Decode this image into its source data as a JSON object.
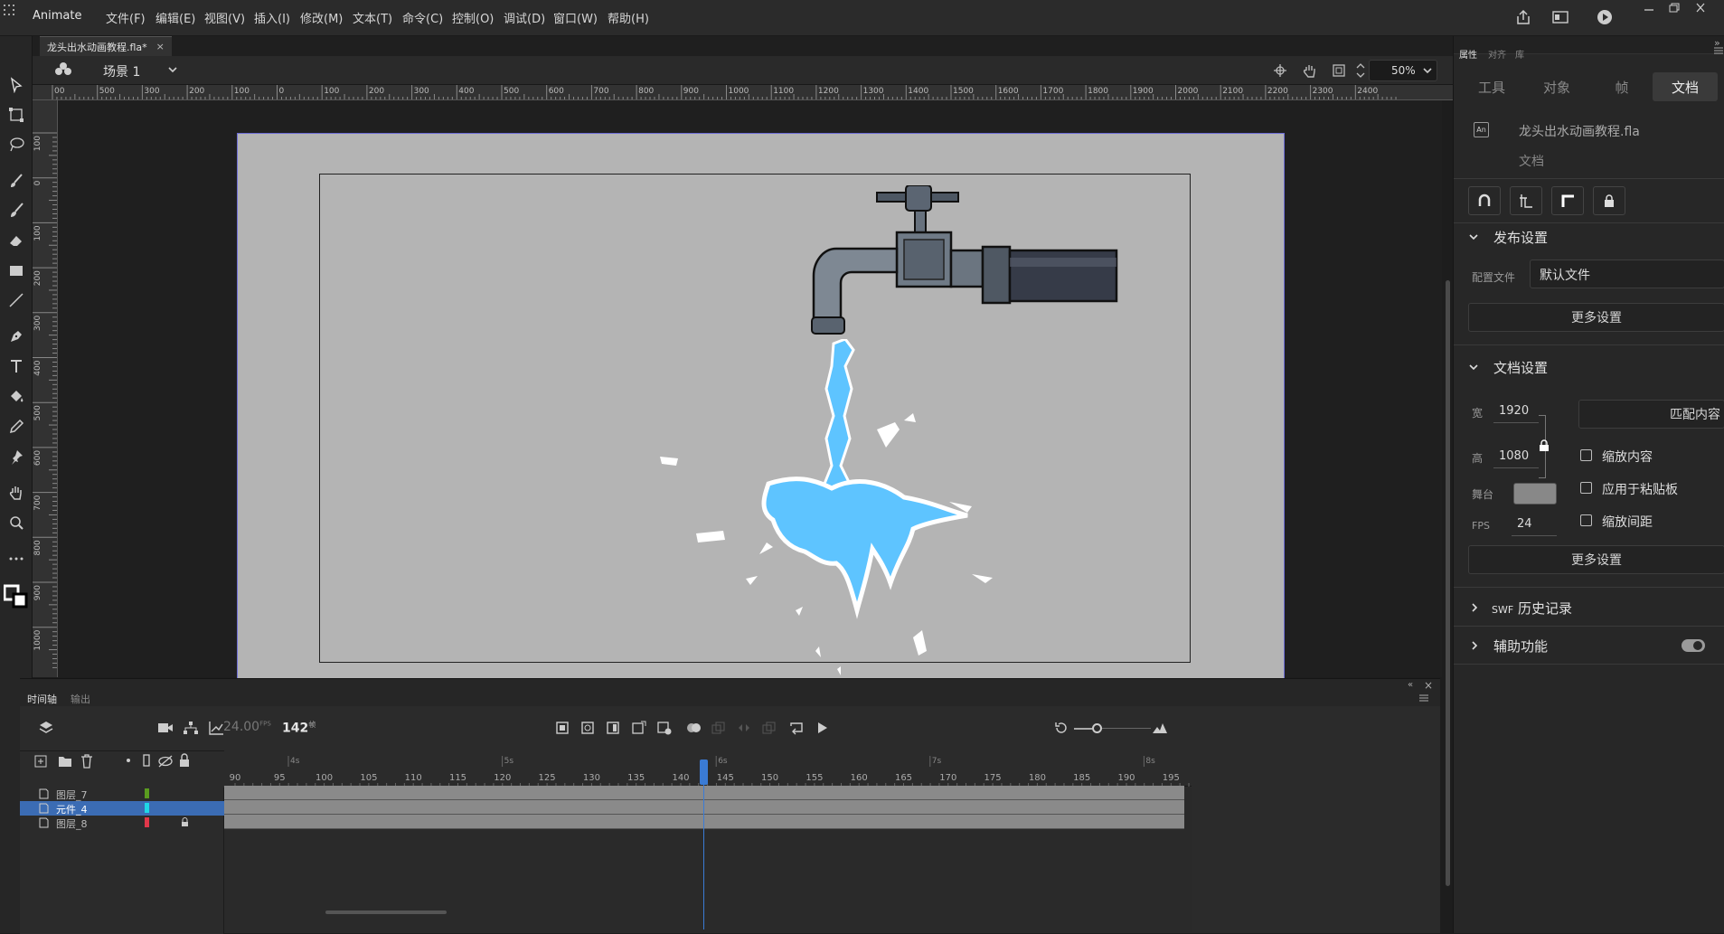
{
  "app": {
    "name": "Animate"
  },
  "menu": [
    "文件(F)",
    "编辑(E)",
    "视图(V)",
    "插入(I)",
    "修改(M)",
    "文本(T)",
    "命令(C)",
    "控制(O)",
    "调试(D)",
    "窗口(W)",
    "帮助(H)"
  ],
  "document": {
    "tab_label": "龙头出水动画教程.fla*"
  },
  "scene": {
    "label": "场景 1",
    "zoom": "50%"
  },
  "rulers": {
    "h_labels": [
      "00",
      "500",
      "300",
      "200",
      "100",
      "0",
      "100",
      "200",
      "300",
      "400",
      "500",
      "600",
      "700",
      "800",
      "900",
      "1000",
      "1100",
      "1200",
      "1300",
      "1400",
      "1500",
      "1600",
      "1700",
      "1800",
      "1900",
      "2000",
      "2100",
      "2200",
      "2300",
      "2400"
    ],
    "v_labels": [
      "100",
      "0",
      "100",
      "200",
      "300",
      "400",
      "500",
      "600",
      "700",
      "800",
      "900",
      "1000"
    ]
  },
  "timeline": {
    "tabs": [
      "时间轴",
      "输出"
    ],
    "fps": "24.00",
    "fps_unit": "FPS",
    "frame": "142",
    "frame_unit": "帧",
    "second_marks": [
      "4s",
      "5s",
      "6s",
      "7s",
      "8s"
    ],
    "frame_numbers": [
      "90",
      "95",
      "100",
      "105",
      "110",
      "115",
      "120",
      "125",
      "130",
      "135",
      "140",
      "145",
      "150",
      "155",
      "160",
      "165",
      "170",
      "175",
      "180",
      "185",
      "190",
      "195"
    ],
    "layers": [
      {
        "name": "图层_7",
        "color": "#5a9b1f",
        "selected": false,
        "locked": false
      },
      {
        "name": "元件_4",
        "color": "#1fd7e6",
        "selected": true,
        "locked": false
      },
      {
        "name": "图层_8",
        "color": "#e0374a",
        "selected": false,
        "locked": true
      }
    ]
  },
  "properties": {
    "panel_tabs": [
      "属性",
      "对齐",
      "库"
    ],
    "tabs": [
      "工具",
      "对象",
      "帧",
      "文档"
    ],
    "active_tab": "文档",
    "file_name": "龙头出水动画教程.fla",
    "file_type": "文档",
    "publish": {
      "title": "发布设置",
      "profile_label": "配置文件",
      "profile_value": "默认文件",
      "more_button": "更多设置"
    },
    "doc_settings": {
      "title": "文档设置",
      "width_label": "宽",
      "width": "1920",
      "height_label": "高",
      "height": "1080",
      "stage_label": "舞台",
      "stage_color": "#b4b4b4",
      "fps_label": "FPS",
      "fps": "24",
      "match_button": "匹配内容",
      "checks": [
        "缩放内容",
        "应用于粘贴板",
        "缩放间距"
      ],
      "more_button": "更多设置"
    },
    "swf_history": {
      "prefix": "SWF",
      "title": "历史记录"
    },
    "accessibility": {
      "title": "辅助功能"
    }
  }
}
